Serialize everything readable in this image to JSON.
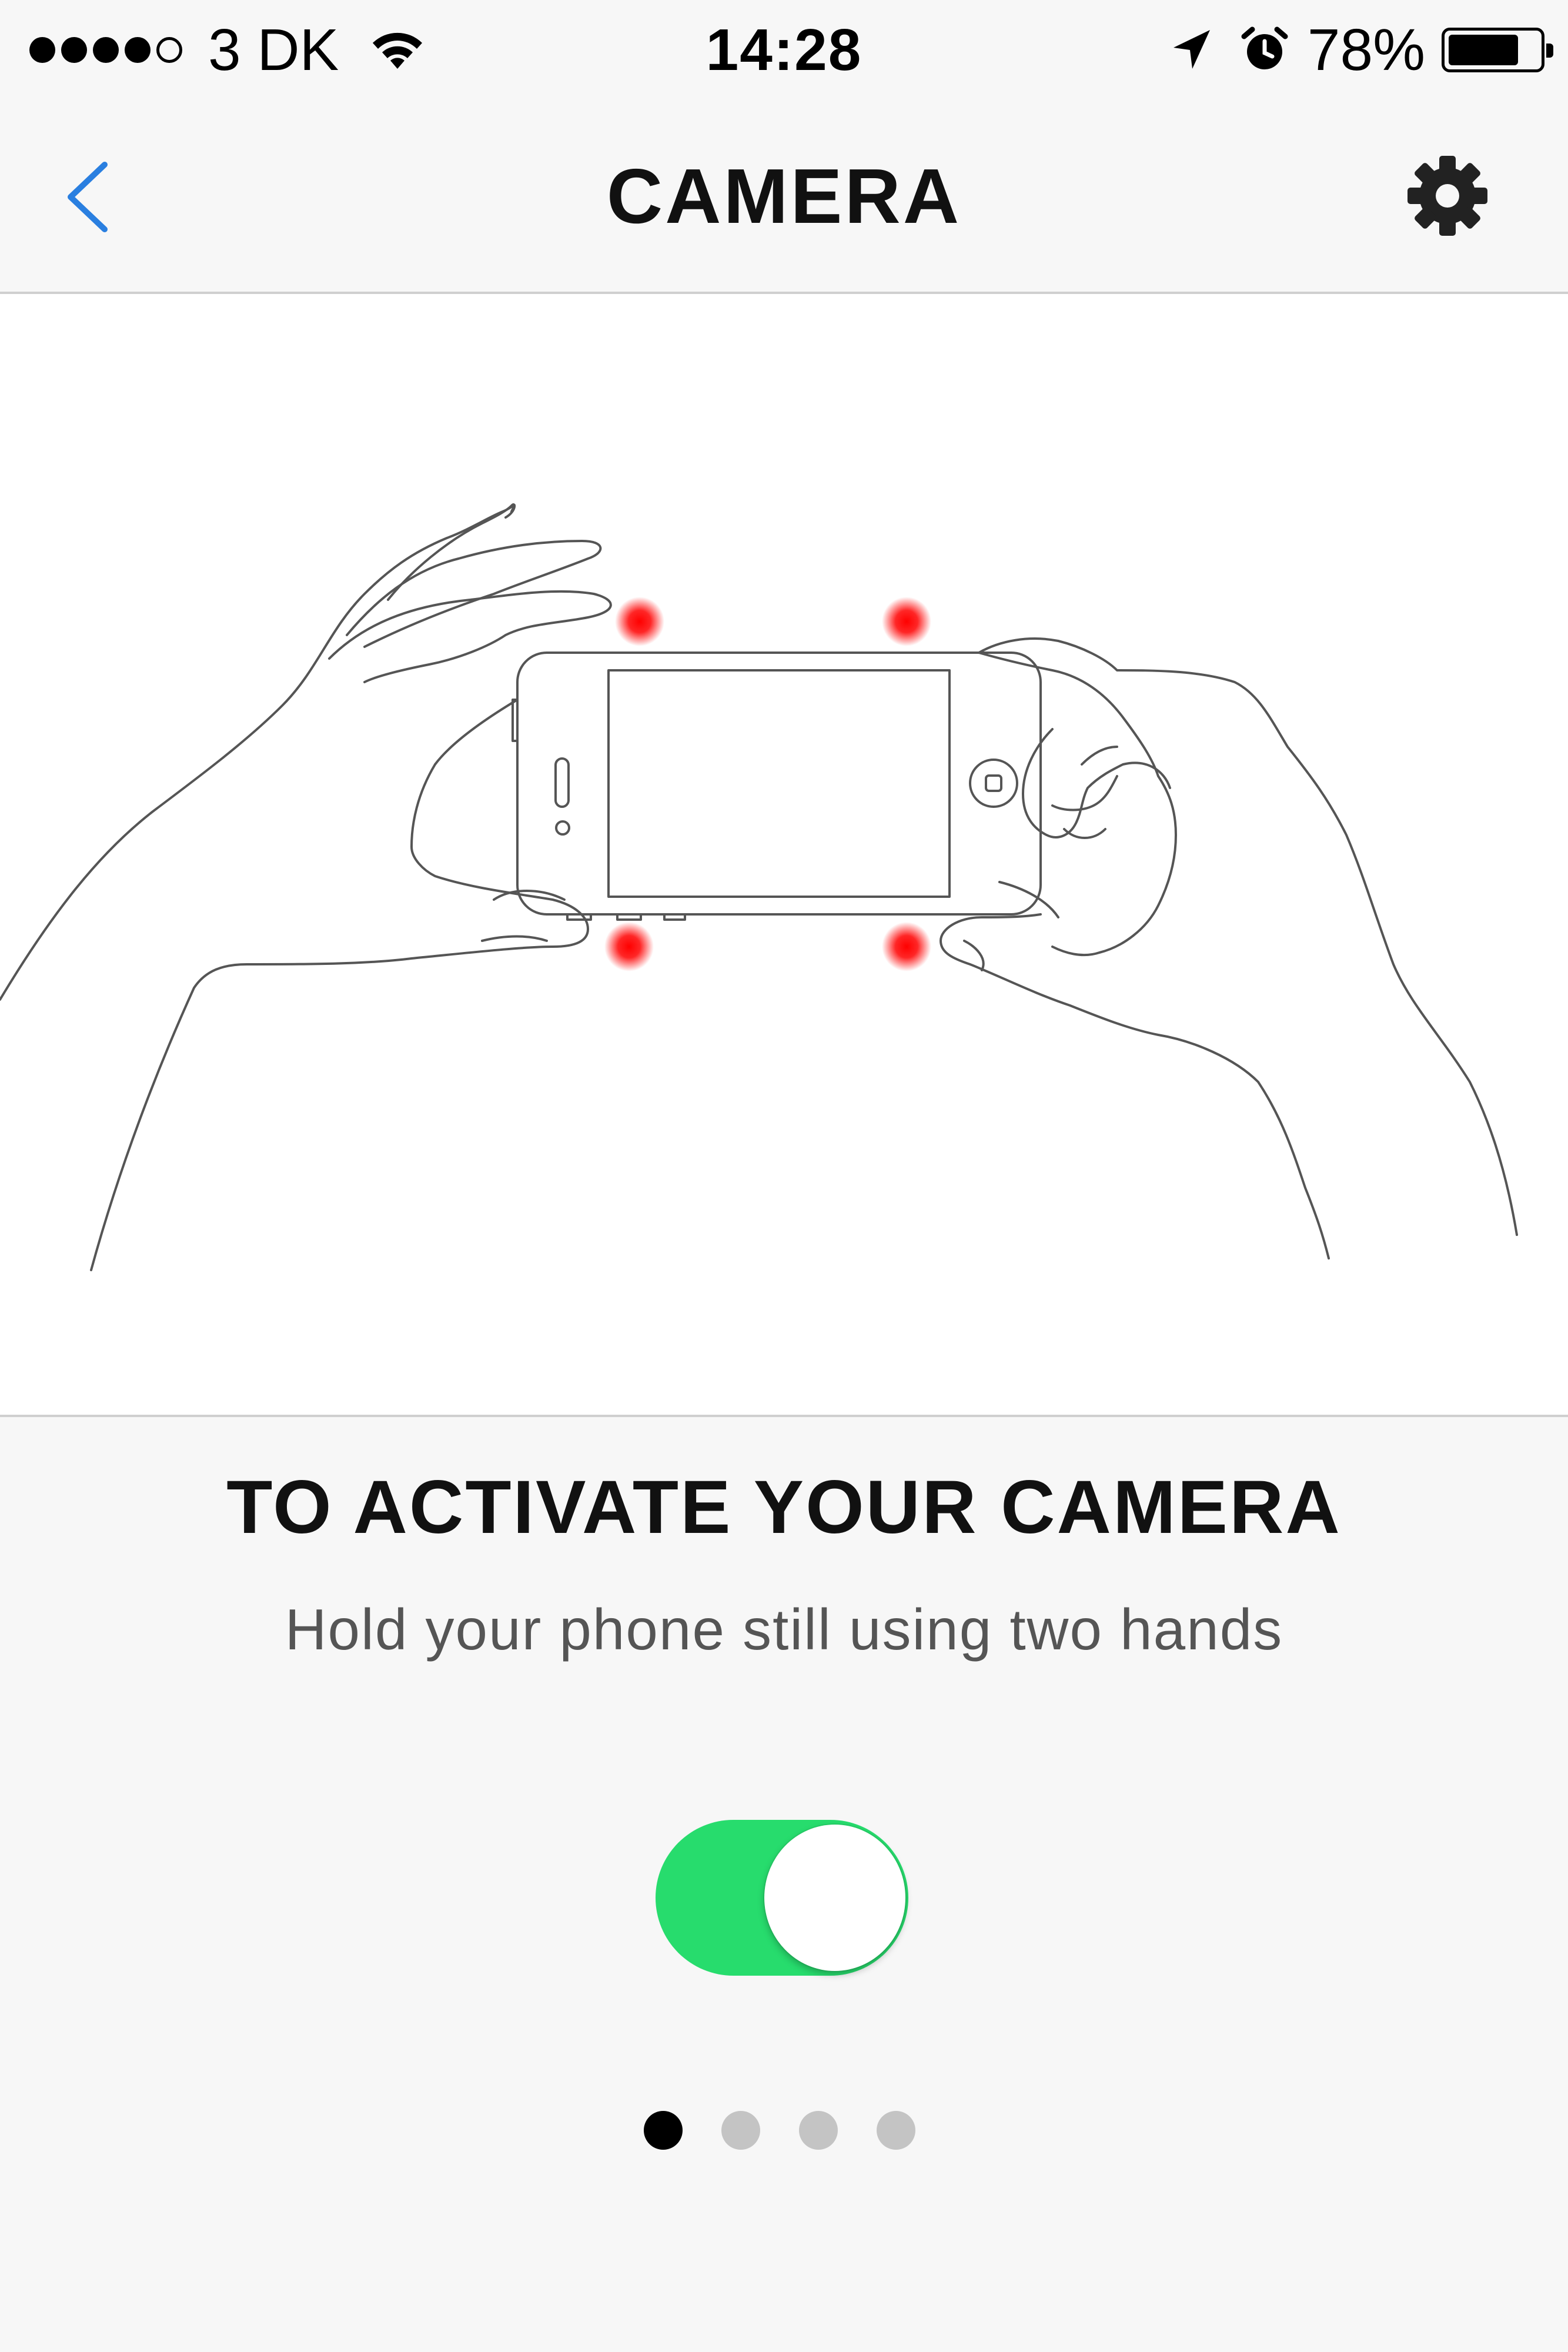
{
  "status_bar": {
    "signal_strength": 4,
    "signal_max": 5,
    "carrier": "3 DK",
    "wifi_icon": "wifi-icon",
    "time": "14:28",
    "location_icon": "location-arrow-icon",
    "alarm_icon": "alarm-icon",
    "battery_percent": "78%",
    "battery_level": 0.78
  },
  "nav_bar": {
    "back_icon": "chevron-left-icon",
    "title": "CAMERA",
    "settings_icon": "gear-icon"
  },
  "illustration": {
    "description_icon": "two-hands-holding-phone-illustration",
    "marker_color": "#ff0000"
  },
  "content": {
    "heading": "TO ACTIVATE YOUR CAMERA",
    "subtext": "Hold your phone still using two hands"
  },
  "toggle": {
    "state": "on",
    "on_color": "#27dc6d"
  },
  "page_indicator": {
    "total": 4,
    "current": 1
  },
  "colors": {
    "accent": "#2a7fe0",
    "background": "#f7f7f7"
  }
}
